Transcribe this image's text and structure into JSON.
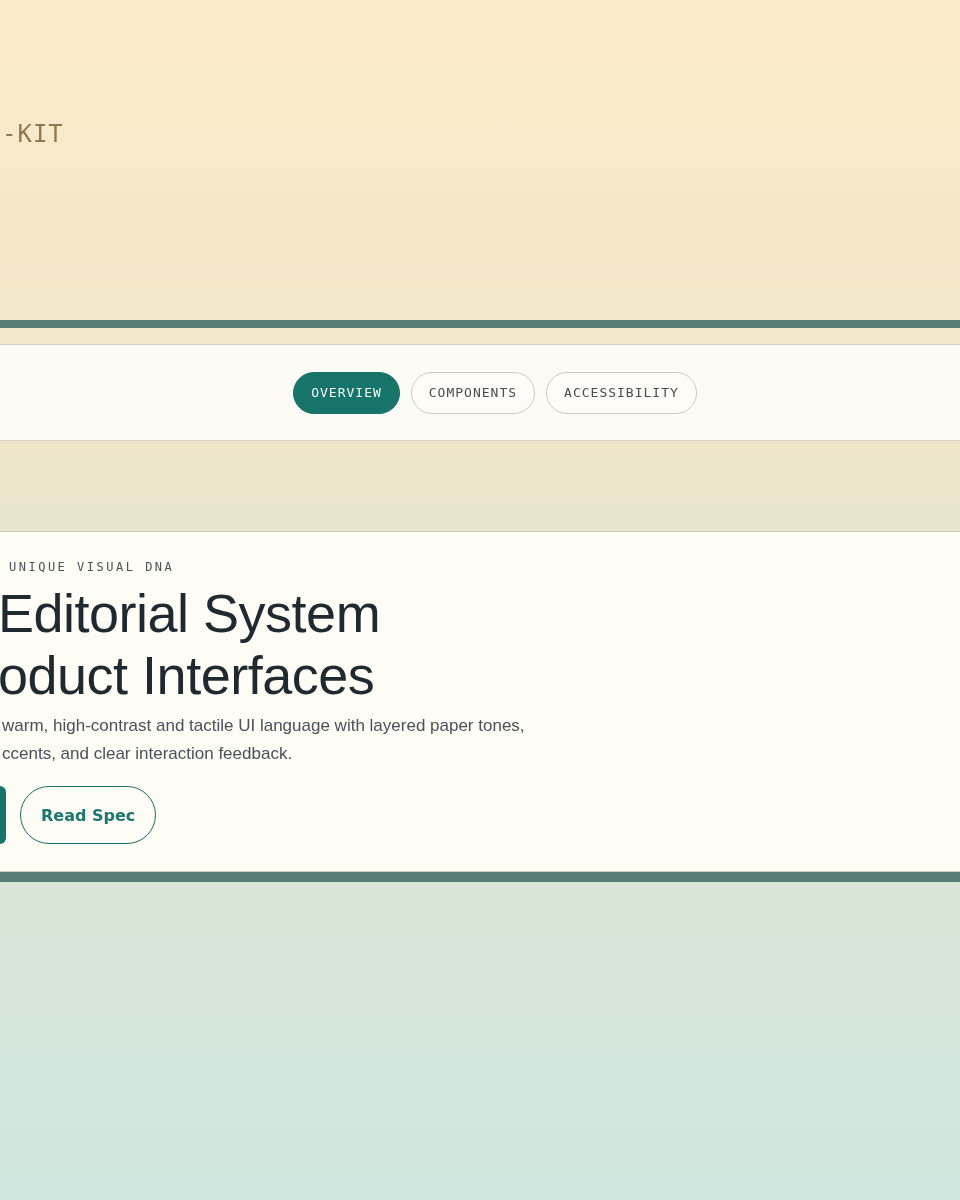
{
  "brand": {
    "text": "-KIT"
  },
  "nav": {
    "tabs": [
      {
        "label": "OVERVIEW",
        "selected": true
      },
      {
        "label": "COMPONENTS",
        "selected": false
      },
      {
        "label": "ACCESSIBILITY",
        "selected": false
      }
    ]
  },
  "hero": {
    "eyebrow": "UNIQUE VISUAL DNA",
    "title_lines": [
      "Editorial System",
      "oduct Interfaces"
    ],
    "description_lines": [
      "warm, high-contrast and tactile UI language with layered paper tones,",
      "ccents, and clear interaction feedback."
    ],
    "buttons": [
      {
        "kind": "primary"
      },
      {
        "kind": "outline",
        "label": "Read Spec"
      }
    ]
  }
}
